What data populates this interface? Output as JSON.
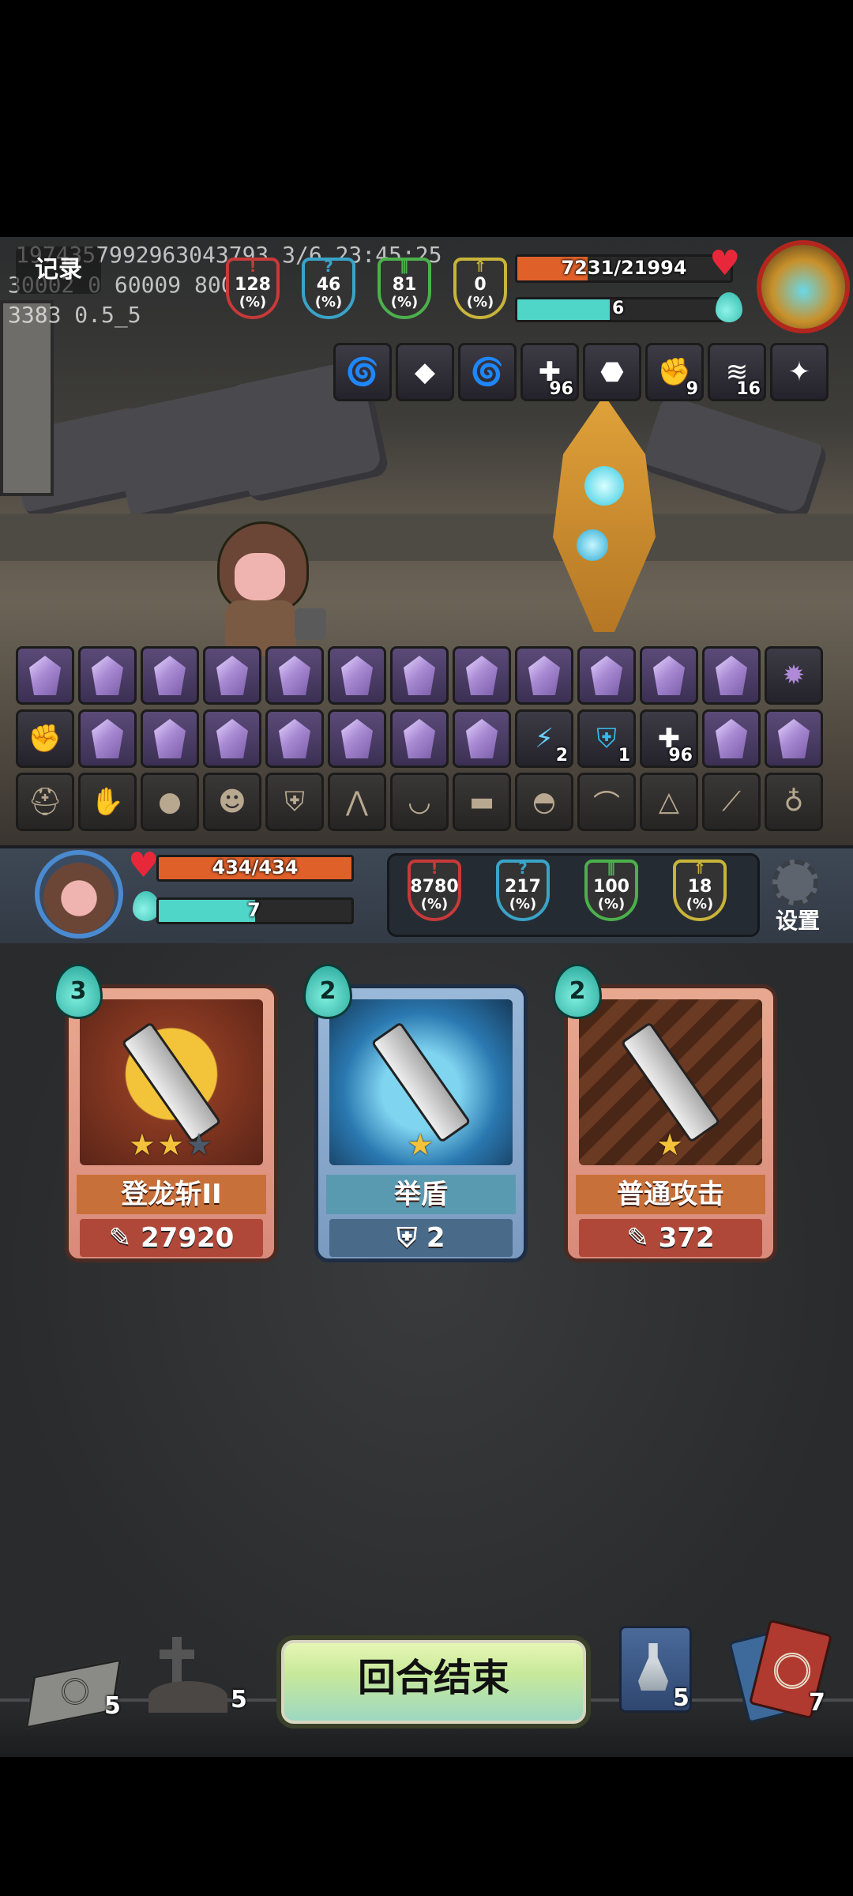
{
  "debug": {
    "line1": "1974357992963043793 3/6 23:45:25",
    "line2": "30002 0 60009 800",
    "line3": "3383 0.5_5"
  },
  "log_button": "记录",
  "enemy": {
    "hp_text": "7231/21994",
    "hp_fraction": 0.329,
    "energy": "6",
    "energy_fraction": 0.45,
    "stats": [
      {
        "value": "128",
        "unit": "(%)",
        "color": "#c83a3a"
      },
      {
        "value": "46",
        "unit": "(%)",
        "color": "#3aa3c8"
      },
      {
        "value": "81",
        "unit": "(%)",
        "color": "#4cb04c"
      },
      {
        "value": "0",
        "unit": "(%)",
        "color": "#c8b43a"
      }
    ],
    "buffs": [
      {
        "icon": "swirl-icon",
        "count": ""
      },
      {
        "icon": "amulet-icon",
        "count": ""
      },
      {
        "icon": "swirl-icon",
        "count": ""
      },
      {
        "icon": "voodoo-doll-icon",
        "count": "96"
      },
      {
        "icon": "dark-orb-icon",
        "count": ""
      },
      {
        "icon": "rock-fist-icon",
        "count": "9"
      },
      {
        "icon": "claw-slash-icon",
        "count": "16"
      },
      {
        "icon": "beast-icon",
        "count": ""
      }
    ]
  },
  "player_buffs": {
    "row1": [
      "",
      "",
      "",
      "",
      "",
      "",
      "",
      "",
      "",
      "",
      "",
      ""
    ],
    "row1_last": "dark-crystal-icon",
    "row2": [
      {
        "icon": "fist-icon",
        "count": ""
      },
      {
        "icon": "gem-icon",
        "count": ""
      },
      {
        "icon": "gem-icon",
        "count": ""
      },
      {
        "icon": "gem-icon",
        "count": ""
      },
      {
        "icon": "gem-icon",
        "count": ""
      },
      {
        "icon": "gem-icon",
        "count": ""
      },
      {
        "icon": "gem-icon",
        "count": ""
      },
      {
        "icon": "gem-icon",
        "count": ""
      },
      {
        "icon": "lightning-icon",
        "count": "2"
      },
      {
        "icon": "shield-icon",
        "count": "1"
      },
      {
        "icon": "voodoo-doll-icon",
        "count": "96"
      },
      {
        "icon": "gem-icon",
        "count": ""
      },
      {
        "icon": "gem-icon",
        "count": ""
      }
    ],
    "relics": [
      "helmet-icon",
      "gauntlet-icon",
      "pouch-icon",
      "doll-icon",
      "armor-icon",
      "trap-icon",
      "cup-icon",
      "bracer-icon",
      "mask-icon",
      "fang-icon",
      "hood-icon",
      "dagger-icon",
      "chalice-icon"
    ]
  },
  "player": {
    "hp_text": "434/434",
    "hp_fraction": 1.0,
    "energy": "7",
    "energy_fraction": 0.5,
    "stats": [
      {
        "value": "8780",
        "unit": "(%)",
        "color": "#c83a3a"
      },
      {
        "value": "217",
        "unit": "(%)",
        "color": "#3aa3c8"
      },
      {
        "value": "100",
        "unit": "(%)",
        "color": "#4cb04c"
      },
      {
        "value": "18",
        "unit": "(%)",
        "color": "#c8b43a"
      }
    ],
    "settings_label": "设置"
  },
  "cards": [
    {
      "cost": "3",
      "name": "登龙斩II",
      "value": "27920",
      "value_icon": "sword-icon",
      "stars": 2,
      "max_stars": 3,
      "theme": "red"
    },
    {
      "cost": "2",
      "name": "举盾",
      "value": "2",
      "value_icon": "shield-icon",
      "stars": 1,
      "max_stars": 1,
      "theme": "blue"
    },
    {
      "cost": "2",
      "name": "普通攻击",
      "value": "372",
      "value_icon": "sword-icon",
      "stars": 1,
      "max_stars": 1,
      "theme": "red"
    }
  ],
  "bottom": {
    "draw_pile": "5",
    "grave_pile": "5",
    "end_turn": "回合结束",
    "potion_count": "5",
    "discard_pile": "7"
  }
}
